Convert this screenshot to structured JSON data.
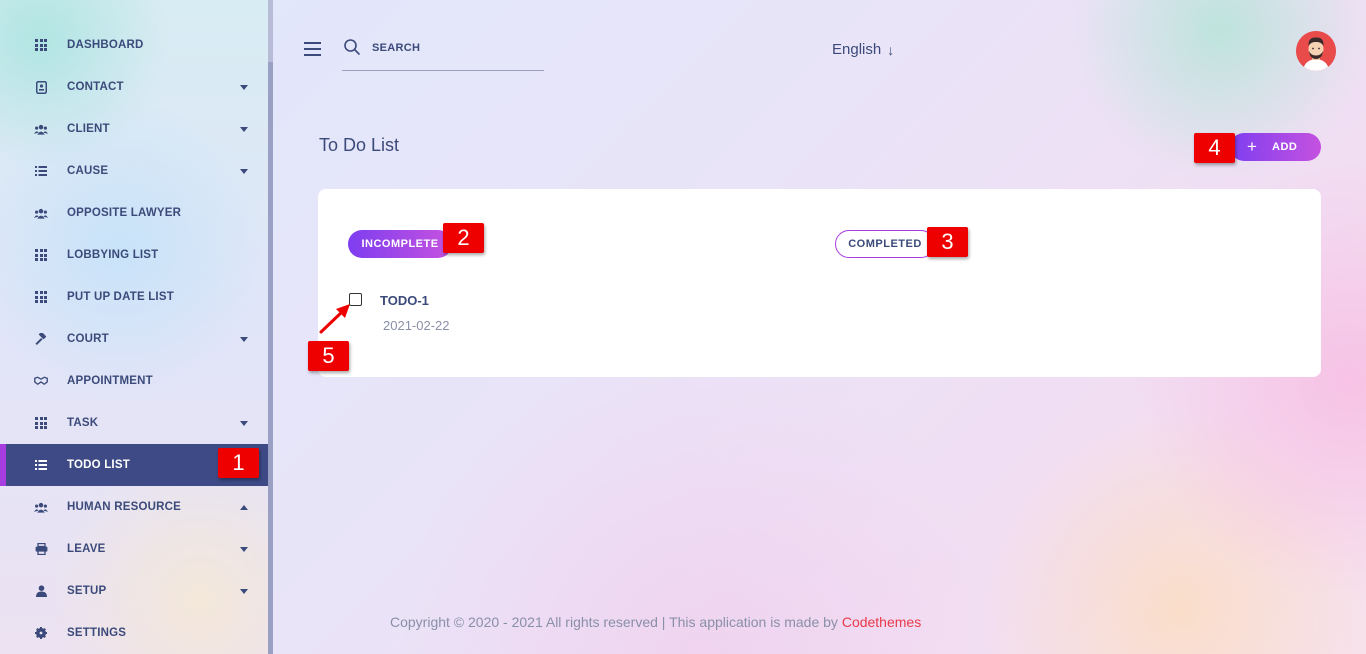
{
  "sidebar": {
    "items": [
      {
        "label": "DASHBOARD",
        "icon": "grid-icon",
        "caret": null
      },
      {
        "label": "CONTACT",
        "icon": "contact-card-icon",
        "caret": "down"
      },
      {
        "label": "CLIENT",
        "icon": "users-icon",
        "caret": "down"
      },
      {
        "label": "CAUSE",
        "icon": "list-icon",
        "caret": "down"
      },
      {
        "label": "OPPOSITE LAWYER",
        "icon": "users-icon",
        "caret": null
      },
      {
        "label": "LOBBYING LIST",
        "icon": "grid-icon",
        "caret": null
      },
      {
        "label": "PUT UP DATE LIST",
        "icon": "grid-icon",
        "caret": null
      },
      {
        "label": "COURT",
        "icon": "gavel-icon",
        "caret": "down"
      },
      {
        "label": "APPOINTMENT",
        "icon": "handshake-icon",
        "caret": null
      },
      {
        "label": "TASK",
        "icon": "grid-icon",
        "caret": "down"
      },
      {
        "label": "TODO LIST",
        "icon": "list-icon",
        "caret": null,
        "active": true
      },
      {
        "label": "HUMAN RESOURCE",
        "icon": "users-icon",
        "caret": "up"
      },
      {
        "label": "LEAVE",
        "icon": "printer-icon",
        "caret": "down"
      },
      {
        "label": "SETUP",
        "icon": "user-icon",
        "caret": "down"
      },
      {
        "label": "SETTINGS",
        "icon": "gear-icon",
        "caret": null
      }
    ]
  },
  "header": {
    "search_placeholder": "SEARCH",
    "language": "English",
    "language_arrow": "↓"
  },
  "main": {
    "title": "To Do List",
    "add_button_plus": "+",
    "add_button_label": "ADD",
    "tabs": {
      "incomplete": "INCOMPLETE",
      "completed": "COMPLETED"
    },
    "todo": {
      "title": "TODO-1",
      "date": "2021-02-22",
      "checked": false
    }
  },
  "annotations": {
    "n1": "1",
    "n2": "2",
    "n3": "3",
    "n4": "4",
    "n5": "5"
  },
  "footer": {
    "text": "Copyright © 2020 - 2021 All rights reserved | This application is made by ",
    "brand": "Codethemes"
  },
  "colors": {
    "accent_purple": "#a73de0",
    "active_nav_bg": "#3d4a86",
    "text_primary": "#3b4a7a",
    "annotation_red": "#ee0000",
    "footer_brand": "#e83a4a"
  }
}
